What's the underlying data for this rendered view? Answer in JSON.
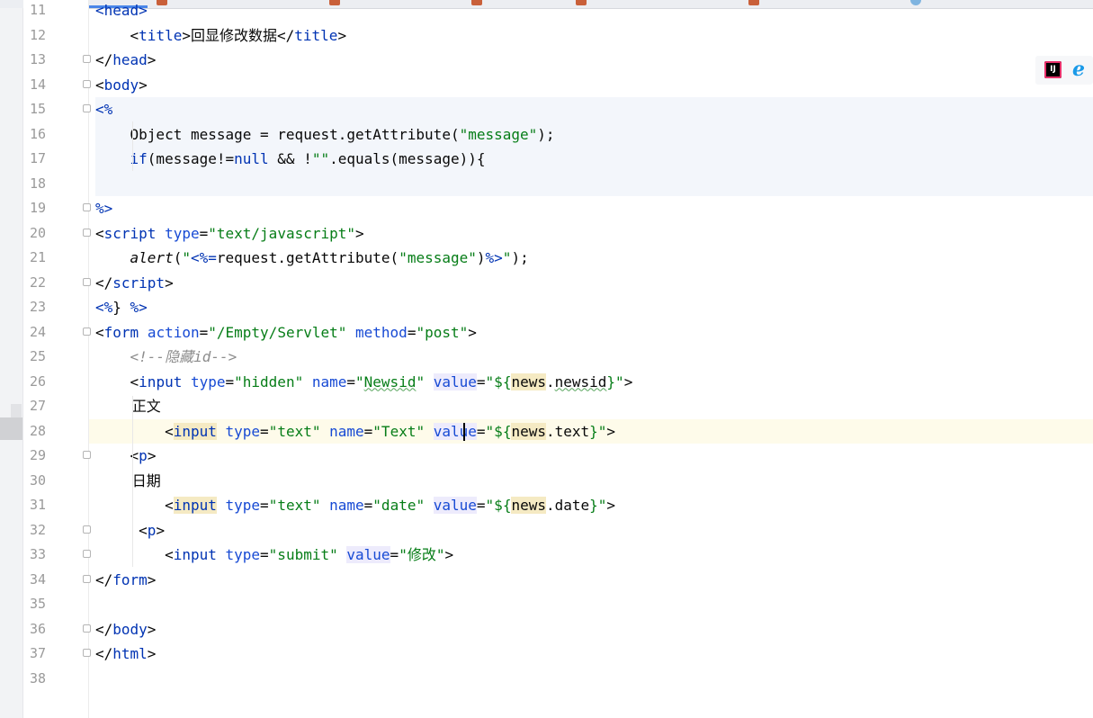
{
  "editor": {
    "lines": [
      {
        "num": "11",
        "segs": [
          [
            "d",
            "<"
          ],
          [
            "t",
            "head"
          ],
          [
            "d",
            ">"
          ]
        ]
      },
      {
        "num": "12",
        "segs": [
          [
            "p",
            "    <"
          ],
          [
            "t",
            "title"
          ],
          [
            "p",
            ">"
          ],
          [
            "cjk",
            "回显修改数据"
          ],
          [
            "p",
            "</"
          ],
          [
            "t",
            "title"
          ],
          [
            "p",
            ">"
          ]
        ]
      },
      {
        "num": "13",
        "segs": [
          [
            "p",
            "</"
          ],
          [
            "t",
            "head"
          ],
          [
            "p",
            ">"
          ]
        ]
      },
      {
        "num": "14",
        "segs": [
          [
            "p",
            "<"
          ],
          [
            "t",
            "body"
          ],
          [
            "p",
            ">"
          ]
        ]
      },
      {
        "num": "15",
        "segs": [
          [
            "d",
            "<%"
          ]
        ]
      },
      {
        "num": "16",
        "segs": [
          [
            "p",
            "    Object message = request.getAttribute("
          ],
          [
            "s",
            "\"message\""
          ],
          [
            "p",
            ");"
          ]
        ]
      },
      {
        "num": "17",
        "segs": [
          [
            "k",
            "    if"
          ],
          [
            "p",
            "(message!="
          ],
          [
            "k",
            "null"
          ],
          [
            "p",
            " && !"
          ],
          [
            "s",
            "\"\""
          ],
          [
            "p",
            ".equals(message)){"
          ]
        ]
      },
      {
        "num": "18",
        "segs": []
      },
      {
        "num": "19",
        "segs": [
          [
            "d",
            "%>"
          ]
        ]
      },
      {
        "num": "20",
        "segs": [
          [
            "p",
            "<"
          ],
          [
            "t",
            "script "
          ],
          [
            "a",
            "type"
          ],
          [
            "p",
            "="
          ],
          [
            "s",
            "\"text/javascript\""
          ],
          [
            "p",
            ">"
          ]
        ]
      },
      {
        "num": "21",
        "segs": [
          [
            "it",
            "    alert"
          ],
          [
            "p",
            "("
          ],
          [
            "s",
            "\""
          ],
          [
            "d",
            "<%="
          ],
          [
            "p",
            "request.getAttribute("
          ],
          [
            "s",
            "\"message\""
          ],
          [
            "p",
            ")"
          ],
          [
            "d",
            "%>"
          ],
          [
            "s",
            "\""
          ],
          [
            "p",
            ");"
          ]
        ]
      },
      {
        "num": "22",
        "segs": [
          [
            "p",
            "</"
          ],
          [
            "t",
            "script"
          ],
          [
            "p",
            ">"
          ]
        ]
      },
      {
        "num": "23",
        "segs": [
          [
            "d",
            "<%"
          ],
          [
            "p",
            "} "
          ],
          [
            "d",
            "%>"
          ]
        ]
      },
      {
        "num": "24",
        "segs": [
          [
            "p",
            "<"
          ],
          [
            "t",
            "form "
          ],
          [
            "a",
            "action"
          ],
          [
            "p",
            "="
          ],
          [
            "s",
            "\"/Empty/Servlet\""
          ],
          [
            "p",
            " "
          ],
          [
            "a",
            "method"
          ],
          [
            "p",
            "="
          ],
          [
            "s",
            "\"post\""
          ],
          [
            "p",
            ">"
          ]
        ]
      },
      {
        "num": "25",
        "segs": [
          [
            "c",
            "    <!--隐藏id-->"
          ]
        ]
      },
      {
        "num": "26",
        "segs": [
          [
            "p",
            "    <"
          ],
          [
            "t",
            "input "
          ],
          [
            "a",
            "type"
          ],
          [
            "p",
            "="
          ],
          [
            "s",
            "\"hidden\""
          ],
          [
            "p",
            " "
          ],
          [
            "a",
            "name"
          ],
          [
            "p",
            "="
          ],
          [
            "s",
            "\""
          ],
          [
            "su",
            "Newsid"
          ],
          [
            "s",
            "\""
          ],
          [
            "p",
            " "
          ],
          [
            "ah",
            "value"
          ],
          [
            "p",
            "="
          ],
          [
            "s",
            "\"${"
          ],
          [
            "y",
            "news"
          ],
          [
            "p",
            "."
          ],
          [
            "u",
            "newsid"
          ],
          [
            "s",
            "}\""
          ],
          [
            "p",
            ">"
          ]
        ]
      },
      {
        "num": "27",
        "segs": [
          [
            "cjk",
            "        正文"
          ]
        ]
      },
      {
        "num": "28",
        "segs": [
          [
            "p",
            "        <"
          ],
          [
            "ty",
            "input"
          ],
          [
            "p",
            " "
          ],
          [
            "a",
            "type"
          ],
          [
            "p",
            "="
          ],
          [
            "s",
            "\"text\""
          ],
          [
            "p",
            " "
          ],
          [
            "a",
            "name"
          ],
          [
            "p",
            "="
          ],
          [
            "s",
            "\"Text\""
          ],
          [
            "p",
            " "
          ],
          [
            "ah",
            "value"
          ],
          [
            "p",
            "="
          ],
          [
            "s",
            "\"${"
          ],
          [
            "y",
            "news"
          ],
          [
            "p",
            ".text"
          ],
          [
            "s",
            "}\""
          ],
          [
            "p",
            ">"
          ]
        ]
      },
      {
        "num": "29",
        "segs": [
          [
            "p",
            "    <"
          ],
          [
            "t",
            "p"
          ],
          [
            "p",
            ">"
          ]
        ]
      },
      {
        "num": "30",
        "segs": [
          [
            "cjk",
            "        日期"
          ]
        ]
      },
      {
        "num": "31",
        "segs": [
          [
            "p",
            "        <"
          ],
          [
            "ty",
            "input"
          ],
          [
            "p",
            " "
          ],
          [
            "a",
            "type"
          ],
          [
            "p",
            "="
          ],
          [
            "s",
            "\"text\""
          ],
          [
            "p",
            " "
          ],
          [
            "a",
            "name"
          ],
          [
            "p",
            "="
          ],
          [
            "s",
            "\"date\""
          ],
          [
            "p",
            " "
          ],
          [
            "ah",
            "value"
          ],
          [
            "p",
            "="
          ],
          [
            "s",
            "\"${"
          ],
          [
            "y",
            "news"
          ],
          [
            "p",
            ".date"
          ],
          [
            "s",
            "}\""
          ],
          [
            "p",
            ">"
          ]
        ]
      },
      {
        "num": "32",
        "segs": [
          [
            "p",
            "     <"
          ],
          [
            "t",
            "p"
          ],
          [
            "p",
            ">"
          ]
        ]
      },
      {
        "num": "33",
        "segs": [
          [
            "p",
            "        <"
          ],
          [
            "t",
            "input "
          ],
          [
            "a",
            "type"
          ],
          [
            "p",
            "="
          ],
          [
            "s",
            "\"submit\""
          ],
          [
            "p",
            " "
          ],
          [
            "ah",
            "value"
          ],
          [
            "p",
            "="
          ],
          [
            "s",
            "\""
          ],
          [
            "scjk",
            "修改"
          ],
          [
            "s",
            "\""
          ],
          [
            "p",
            ">"
          ]
        ]
      },
      {
        "num": "34",
        "segs": [
          [
            "p",
            "</"
          ],
          [
            "t",
            "form"
          ],
          [
            "p",
            ">"
          ]
        ]
      },
      {
        "num": "35",
        "segs": []
      },
      {
        "num": "36",
        "segs": [
          [
            "p",
            "</"
          ],
          [
            "t",
            "body"
          ],
          [
            "p",
            ">"
          ]
        ]
      },
      {
        "num": "37",
        "segs": [
          [
            "p",
            "</"
          ],
          [
            "t",
            "html"
          ],
          [
            "p",
            ">"
          ]
        ]
      },
      {
        "num": "38",
        "segs": []
      }
    ]
  },
  "browser_bar": {
    "ij_label": "IJ",
    "ie_label": "e"
  }
}
